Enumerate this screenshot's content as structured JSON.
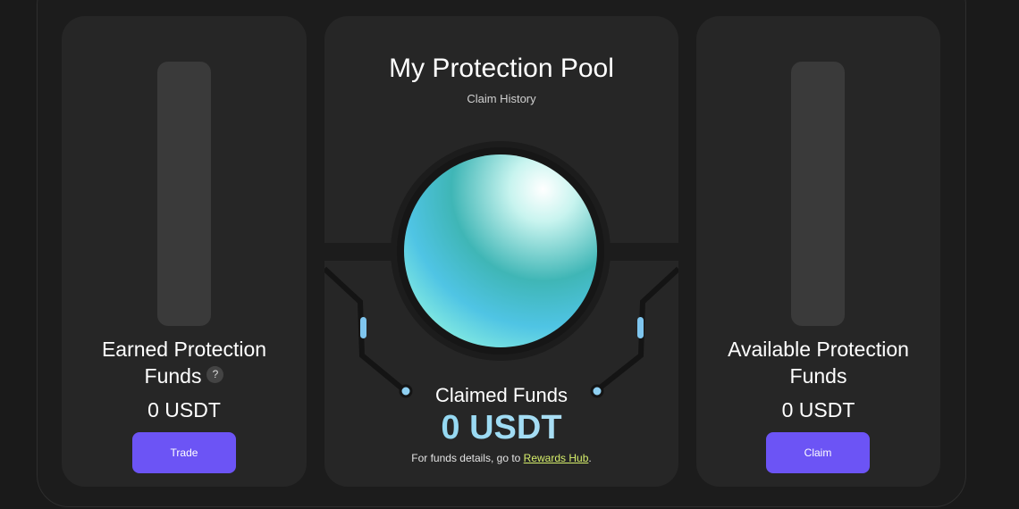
{
  "left_card": {
    "title_line1": "Earned Protection",
    "title_line2": "Funds",
    "help": "?",
    "amount": "0 USDT",
    "button": "Trade"
  },
  "center": {
    "title": "My Protection Pool",
    "history_link": "Claim History",
    "claimed_label": "Claimed Funds",
    "claimed_value": "0 USDT",
    "details_prefix": "For funds details, go to ",
    "details_link": "Rewards Hub",
    "details_suffix": "."
  },
  "right_card": {
    "title_line1": "Available Protection",
    "title_line2": "Funds",
    "amount": "0 USDT",
    "button": "Claim"
  },
  "colors": {
    "accent_button": "#6c54f5",
    "link": "#d7ef6b",
    "value_gradient_start": "#7fd3f0"
  }
}
